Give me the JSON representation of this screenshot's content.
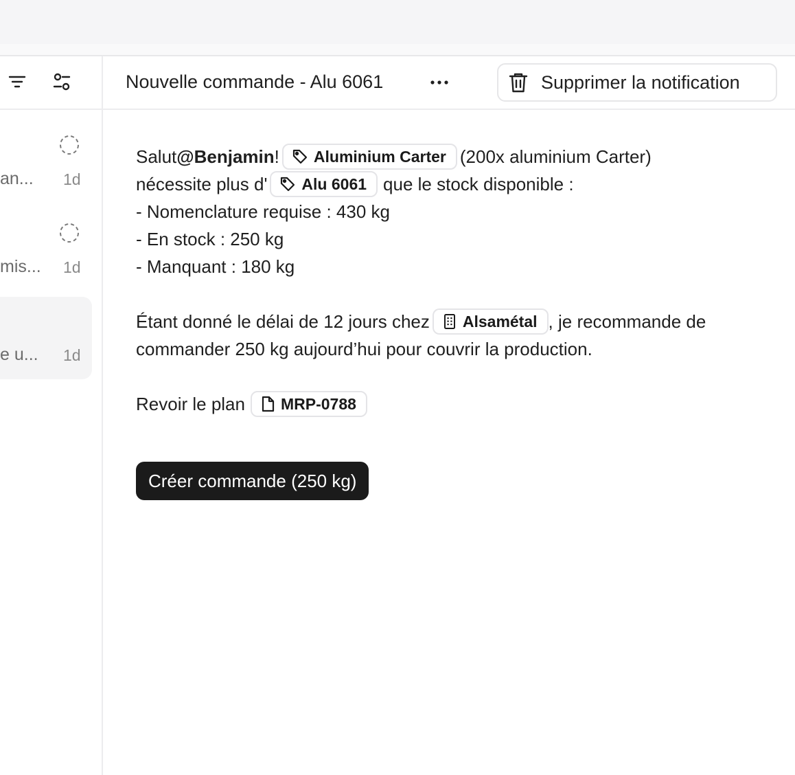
{
  "sidebar": {
    "items": [
      {
        "snippet": "an...",
        "time": "1d"
      },
      {
        "snippet": "mis...",
        "time": "1d"
      },
      {
        "snippet": "e u...",
        "time": "1d"
      }
    ]
  },
  "header": {
    "title": "Nouvelle commande - Alu 6061",
    "delete_label": "Supprimer la notification"
  },
  "message": {
    "greeting": "Salut ",
    "mention": "@Benjamin",
    "after_mention": " !",
    "chip_product": "Aluminium Carter",
    "after_product": "(200x aluminium Carter)",
    "line2_start": "nécessite plus d'",
    "chip_material": "Alu 6061",
    "line2_end": "que le stock disponible :",
    "bullet1": "- Nomenclature requise : 430 kg",
    "bullet2": "- En stock : 250 kg",
    "bullet3": "- Manquant : 180 kg",
    "para2_start": "Étant donné le délai de 12 jours chez",
    "chip_supplier": "Alsamétal",
    "para2_end": ", je recommande de",
    "para2_line2": "commander 250 kg aujourd’hui pour couvrir la production.",
    "review_text": "Revoir le plan",
    "chip_plan": "MRP-0788"
  },
  "cta": {
    "label": "Créer commande (250 kg)"
  },
  "icons": {
    "filter": "filter-icon",
    "sliders": "sliders-icon",
    "status": "status-pending-icon",
    "more": "more-horizontal-icon",
    "trash": "trash-icon",
    "tag": "tag-icon",
    "building": "building-icon",
    "file": "file-icon"
  }
}
